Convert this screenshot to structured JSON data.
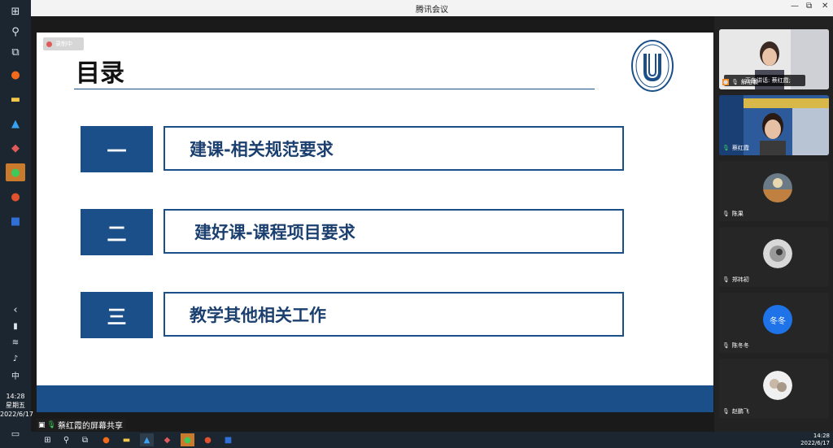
{
  "window": {
    "title": "腾讯会议",
    "minimize": "—",
    "restore": "⧉",
    "close": "✕"
  },
  "recording_badge": "录制中",
  "slide": {
    "title": "目录",
    "items": [
      {
        "num": "一",
        "text": "建课-相关规范要求"
      },
      {
        "num": "二",
        "text": "建好课-课程项目要求"
      },
      {
        "num": "三",
        "text": "教学其他相关工作"
      }
    ]
  },
  "share_label": "蔡红霞的屏幕共享",
  "speaking": "正在讲话: 蔡红霞;",
  "participants": [
    {
      "name": "解裕敏"
    },
    {
      "name": "蔡红霞"
    },
    {
      "name": "陈果"
    },
    {
      "name": "郑祎初"
    },
    {
      "name": "陈冬冬",
      "avatar_text": "冬冬"
    },
    {
      "name": "赵鹏飞"
    }
  ],
  "sidebar_clock": {
    "time": "14:28",
    "weekday": "星期五",
    "date": "2022/6/17"
  },
  "sidebar_tray": {
    "ime": "中"
  },
  "taskbar_clock": {
    "time": "14:28",
    "date": "2022/6/17"
  },
  "colors": {
    "accent_blue": "#1b4f8a",
    "avatar_blue": "#1e73e8"
  }
}
